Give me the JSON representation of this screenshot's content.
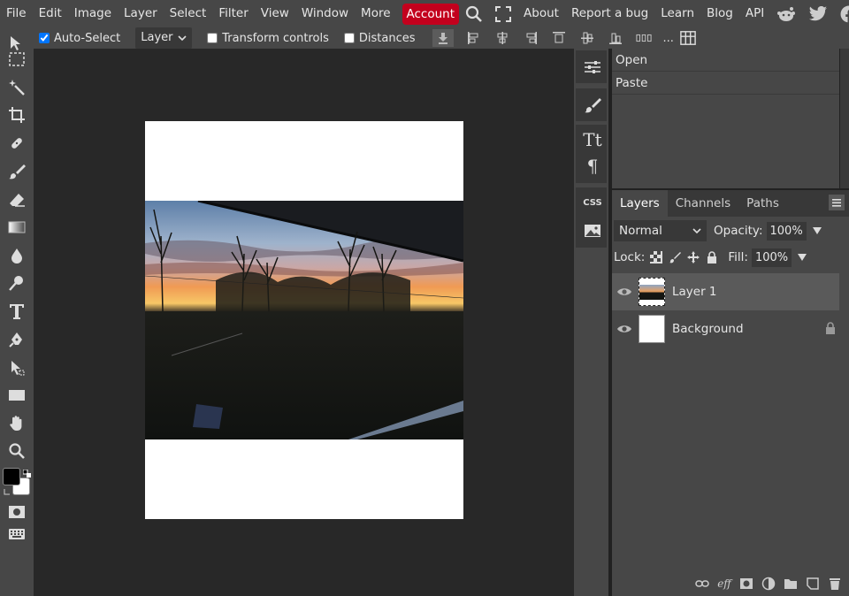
{
  "menu": {
    "items": [
      "File",
      "Edit",
      "Image",
      "Layer",
      "Select",
      "Filter",
      "View",
      "Window",
      "More"
    ],
    "account": "Account",
    "right_links": [
      "About",
      "Report a bug",
      "Learn",
      "Blog",
      "API"
    ]
  },
  "options": {
    "auto_select_label": "Auto-Select",
    "auto_select_checked": true,
    "target_value": "Layer",
    "transform_controls_label": "Transform controls",
    "distances_label": "Distances",
    "more_label": "..."
  },
  "history": {
    "items": [
      "Open",
      "Paste"
    ]
  },
  "minipanel": {
    "text_icon": "Tt",
    "paragraph_icon": "¶",
    "css_label": "CSS"
  },
  "layers_panel": {
    "tabs": [
      "Layers",
      "Channels",
      "Paths"
    ],
    "active_tab": "Layers",
    "blend_mode": "Normal",
    "opacity_label": "Opacity:",
    "opacity_value": "100%",
    "lock_label": "Lock:",
    "fill_label": "Fill:",
    "fill_value": "100%",
    "layers": [
      {
        "name": "Layer 1",
        "selected": true,
        "locked": false
      },
      {
        "name": "Background",
        "selected": false,
        "locked": true
      }
    ]
  },
  "colors": {
    "accent": "#c3001d",
    "foreground": "#000000",
    "background": "#ffffff"
  }
}
